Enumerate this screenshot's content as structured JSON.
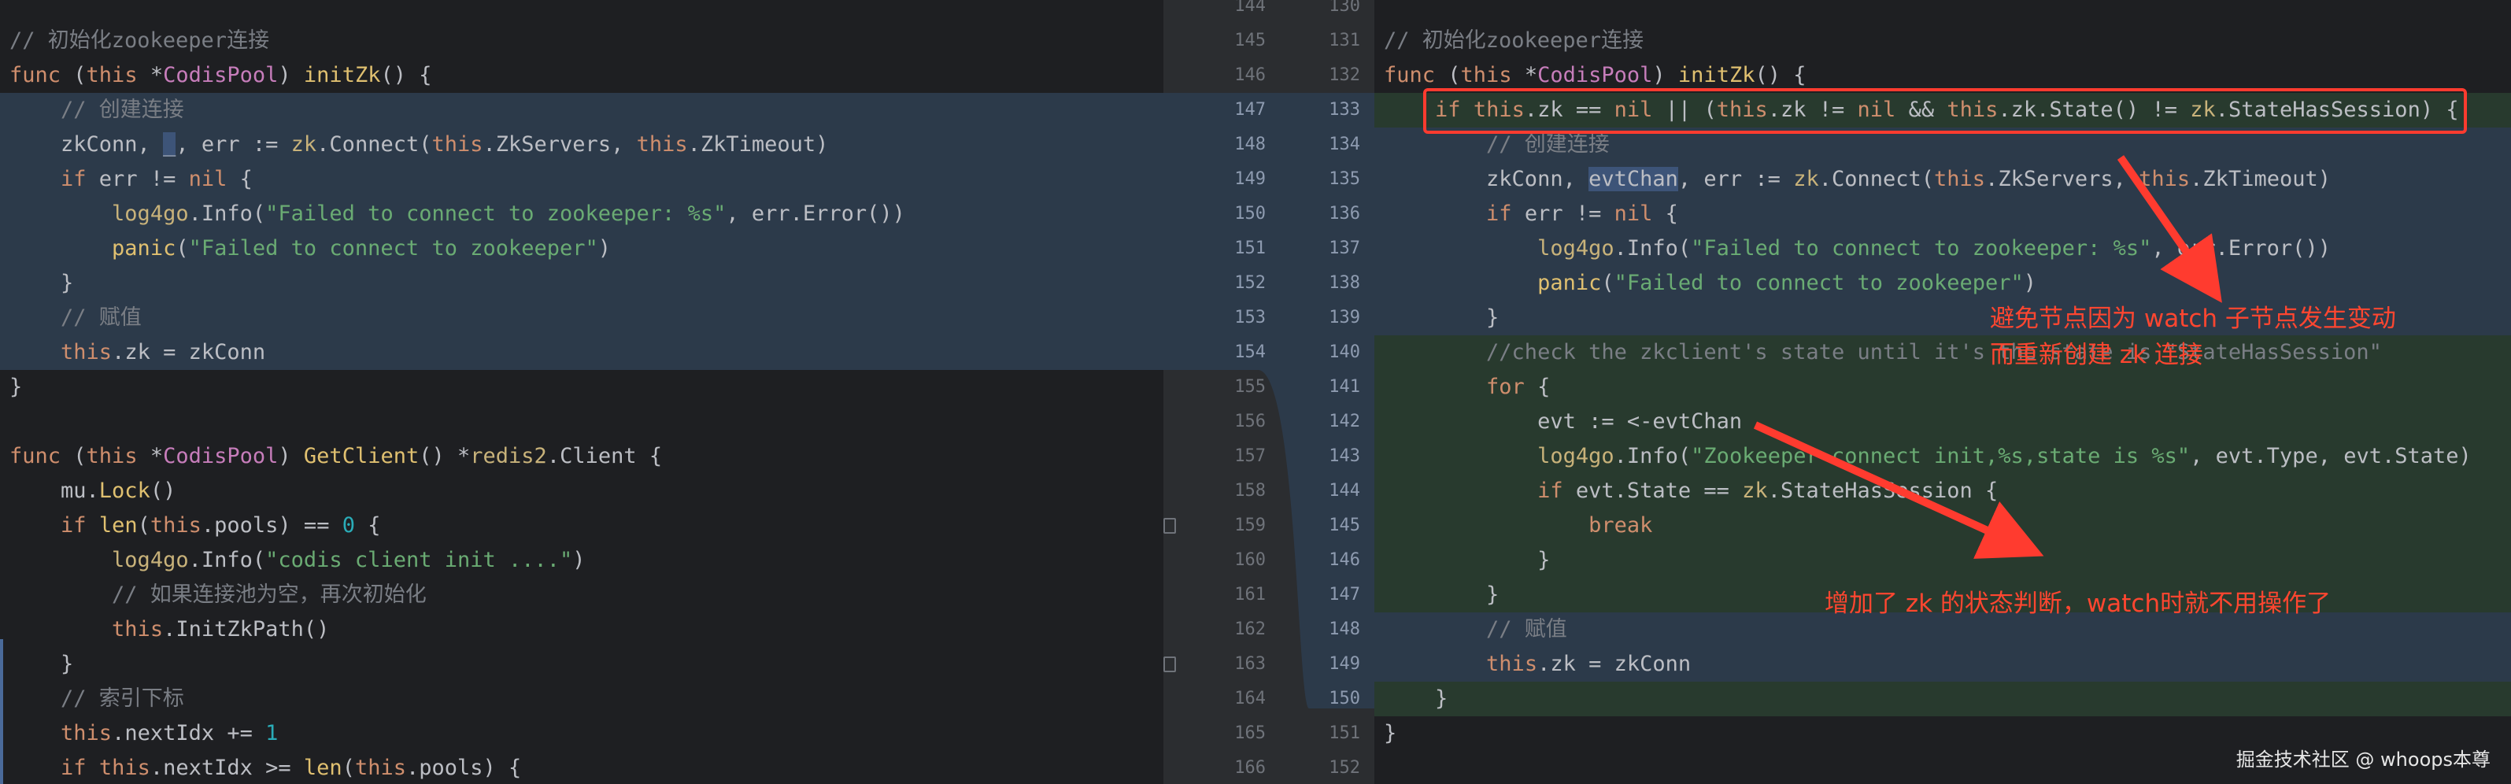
{
  "left_code": {
    "lines": [
      "// 初始化zookeeper连接",
      "func (this *CodisPool) initZk() {",
      "    // 创建连接",
      "    zkConn, _, err := zk.Connect(this.ZkServers, this.ZkTimeout)",
      "    if err != nil {",
      "        log4go.Info(\"Failed to connect to zookeeper: %s\", err.Error())",
      "        panic(\"Failed to connect to zookeeper\")",
      "    }",
      "    // 赋值",
      "    this.zk = zkConn",
      "}",
      "",
      "func (this *CodisPool) GetClient() *redis2.Client {",
      "    mu.Lock()",
      "    if len(this.pools) == 0 {",
      "        log4go.Info(\"codis client init ....\")",
      "        // 如果连接池为空，再次初始化",
      "        this.InitZkPath()",
      "    }",
      "    // 索引下标",
      "    this.nextIdx += 1",
      "    if this.nextIdx >= len(this.pools) {"
    ]
  },
  "right_code": {
    "lines": [
      "// 初始化zookeeper连接",
      "func (this *CodisPool) initZk() {",
      "    if this.zk == nil || (this.zk != nil && this.zk.State() != zk.StateHasSession) {",
      "        // 创建连接",
      "        zkConn, evtChan, err := zk.Connect(this.ZkServers, this.ZkTimeout)",
      "        if err != nil {",
      "            log4go.Info(\"Failed to connect to zookeeper: %s\", err.Error())",
      "            panic(\"Failed to connect to zookeeper\")",
      "        }",
      "        //check the zkclient's state until it's the state is \"StateHasSession\"",
      "        for {",
      "            evt := <-evtChan",
      "            log4go.Info(\"Zookeeper connect init,%s,state is %s\", evt.Type, evt.State)",
      "            if evt.State == zk.StateHasSession {",
      "                break",
      "            }",
      "        }",
      "        // 赋值",
      "        this.zk = zkConn",
      "    }",
      "}"
    ]
  },
  "gutter": {
    "left_numbers": [
      "144",
      "145",
      "146",
      "147",
      "148",
      "149",
      "150",
      "151",
      "152",
      "153",
      "154",
      "155",
      "156",
      "157",
      "158",
      "159",
      "160",
      "161",
      "162",
      "163",
      "164",
      "165",
      "166"
    ],
    "right_numbers": [
      "130",
      "131",
      "132",
      "133",
      "134",
      "135",
      "136",
      "137",
      "138",
      "139",
      "140",
      "141",
      "142",
      "143",
      "144",
      "145",
      "146",
      "147",
      "148",
      "149",
      "150",
      "151",
      "152"
    ]
  },
  "annotations": {
    "top_note_line1": "避免节点因为 watch 子节点发生变动",
    "top_note_line2": "而重新创建 zk 连接",
    "bottom_note": "增加了 zk 的状态判断，watch时就不用操作了"
  },
  "watermark": "掘金技术社区 @ whoops本尊",
  "colors": {
    "annotation_red": "#ff3b2f",
    "diff_blue": "#2c3a4a",
    "diff_green": "#283a2e",
    "keyword": "#cf8e6d",
    "function": "#56a8f5",
    "string": "#6aab73",
    "comment": "#7a7e85"
  }
}
